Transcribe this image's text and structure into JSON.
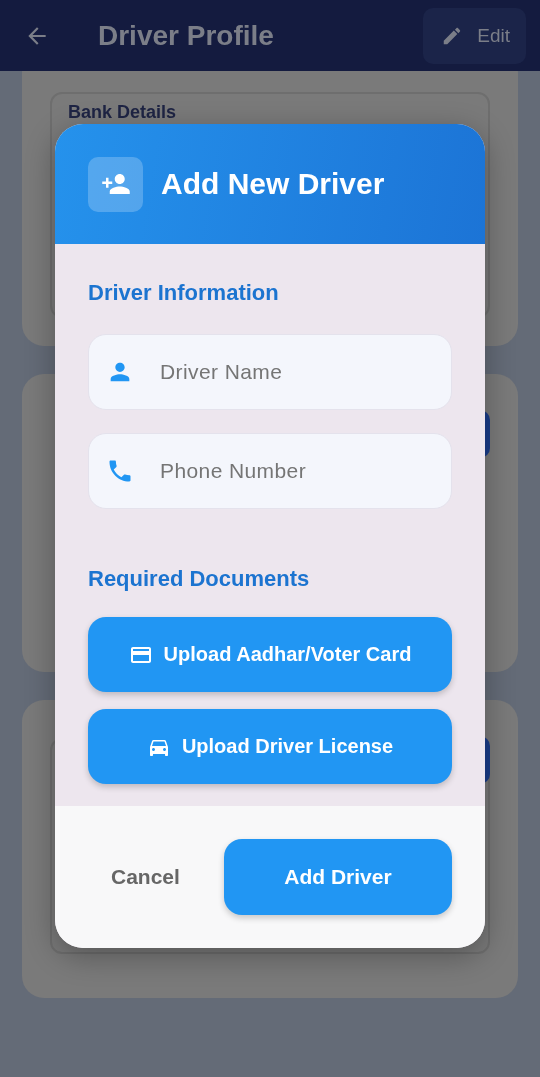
{
  "app_bar": {
    "title": "Driver Profile",
    "edit_button": "Edit"
  },
  "background": {
    "section_title": "Bank Details"
  },
  "dialog": {
    "title": "Add New Driver",
    "section_1": "Driver Information",
    "fields": [
      {
        "kind": "person",
        "placeholder": "Driver Name"
      },
      {
        "kind": "phone",
        "placeholder": "Phone Number"
      }
    ],
    "section_2": "Required Documents",
    "uploads": [
      {
        "kind": "card",
        "label": "Upload Aadhar/Voter Card"
      },
      {
        "kind": "car",
        "label": "Upload Driver License"
      }
    ],
    "cancel": "Cancel",
    "confirm": "Add Driver"
  }
}
